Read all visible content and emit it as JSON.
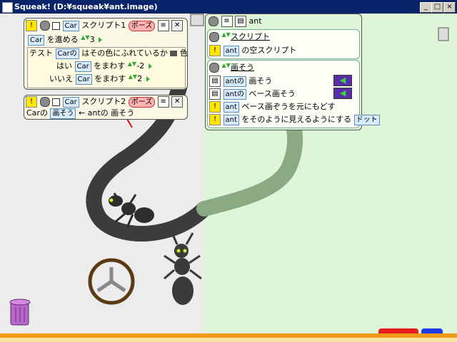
{
  "window": {
    "title": "Squeak! (D:¥squeak¥ant.image)",
    "min": "_",
    "max": "□",
    "close": "×"
  },
  "script1": {
    "title": "スクリプト1",
    "pause": "ポーズ",
    "obj": "Car",
    "line1_obj": "Car",
    "line1_text": "を進める",
    "line1_val": "3",
    "test_label": "テスト",
    "test_obj": "Carの",
    "test_text": "はその色にふれているか",
    "test_tail": "色",
    "yes_label": "はい",
    "yes_obj": "Car",
    "yes_text": "をまわす",
    "yes_val": "-2",
    "no_label": "いいえ",
    "no_obj": "Car",
    "no_text": "をまわす",
    "no_val": "2"
  },
  "script2": {
    "title": "スクリプト2",
    "pause": "ポーズ",
    "obj": "Car",
    "line_obj": "Carの",
    "line_field": "画そう",
    "line_arrow": "←",
    "line_rhs": "antの 画そう"
  },
  "viewer": {
    "name": "ant",
    "sec1_title": "スクリプト",
    "sec1_obj": "ant",
    "sec1_text": "の空スクリプト",
    "sec2_title": "画そう",
    "r1_obj": "antの",
    "r1_text": "画そう",
    "r2_obj": "antの",
    "r2_text": "ベース画そう",
    "r3_obj": "ant",
    "r3_text": "ベース画ぞうを元にもどす",
    "r4_obj": "ant",
    "r4_text": "をそのように見えるようにする",
    "r4_tail": "ドット"
  },
  "colors": {
    "titlebar": "#0a246a",
    "playfield": "#dff5d8",
    "track_dark": "#3c3c3c",
    "track_green": "#8aaa84",
    "stripe": "#f19a1a"
  },
  "icons": [
    "trash-icon",
    "ant-icon",
    "car-wheel-icon",
    "red-arrow-icon",
    "halo-handle-icon"
  ]
}
